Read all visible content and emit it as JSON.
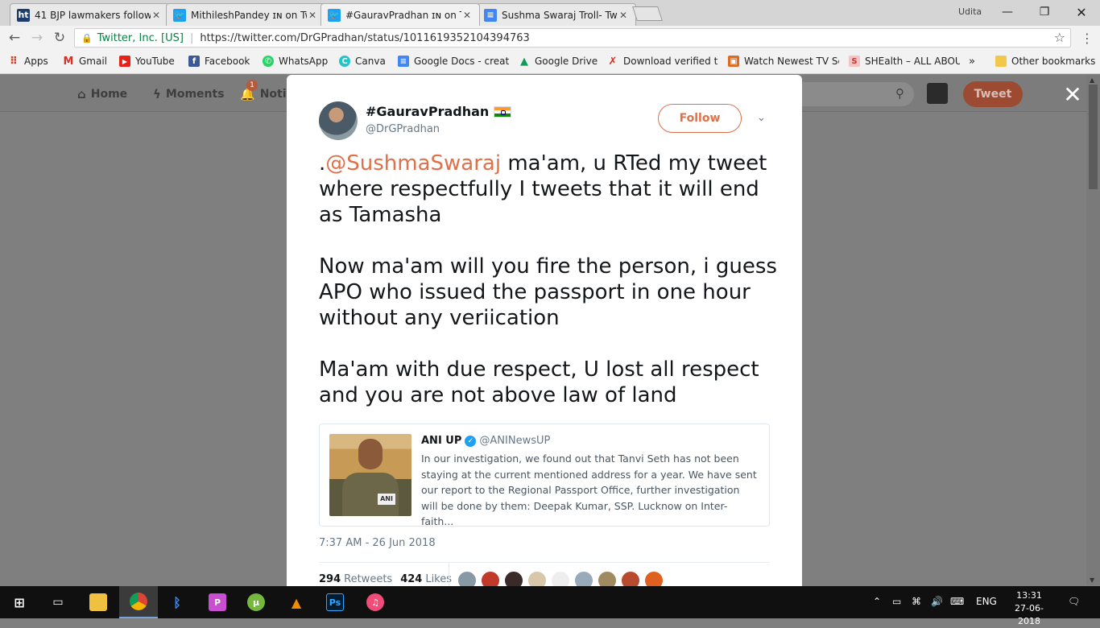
{
  "browser": {
    "tabs": [
      {
        "title": "41 BJP lawmakers follow",
        "icon": "ht-icon"
      },
      {
        "title": "MithileshPandey ɪɴ on Tw",
        "icon": "twitter-bird-icon"
      },
      {
        "title": "#GauravPradhan ɪɴ on Tw",
        "icon": "twitter-bird-icon"
      },
      {
        "title": "Sushma Swaraj Troll- Twit",
        "icon": "google-docs-icon"
      }
    ],
    "user_name": "Udita",
    "site_identity": "Twitter, Inc. [US]",
    "url": "https://twitter.com/DrGPradhan/status/1011619352104394763",
    "bookmarks": [
      {
        "label": "Apps",
        "icon": "apps-grid-icon"
      },
      {
        "label": "Gmail",
        "icon": "gmail-icon"
      },
      {
        "label": "YouTube",
        "icon": "youtube-icon"
      },
      {
        "label": "Facebook",
        "icon": "facebook-icon"
      },
      {
        "label": "WhatsApp",
        "icon": "whatsapp-icon"
      },
      {
        "label": "Canva",
        "icon": "canva-icon"
      },
      {
        "label": "Google Docs - create",
        "icon": "google-docs-icon"
      },
      {
        "label": "Google Drive",
        "icon": "google-drive-icon"
      },
      {
        "label": "Download verified to",
        "icon": "x-icon"
      },
      {
        "label": "Watch Newest TV Se",
        "icon": "tv-icon"
      },
      {
        "label": "SHEalth – ALL ABOU",
        "icon": "shealth-icon"
      }
    ],
    "more_bookmarks": "»",
    "other_bookmarks": "Other bookmarks"
  },
  "twitter_nav": {
    "home": "Home",
    "moments": "Moments",
    "notifications": "Notifi",
    "notification_count": "1",
    "search_placeholder": "r",
    "tweet_button": "Tweet"
  },
  "tweet": {
    "display_name": "#GauravPradhan",
    "handle": "@DrGPradhan",
    "follow_label": "Follow",
    "text_prefix": ".",
    "mention": "@SushmaSwaraj",
    "text_rest": " ma'am, u RTed my tweet where respectfully I tweets that it will end as Tamasha\n\nNow ma'am will you fire the person, i guess APO who issued the passport in one hour without any veriication\n\nMa'am with due respect, U lost all respect and you are not above law of land",
    "timestamp": "7:37 AM - 26 Jun 2018",
    "retweets_count": "294",
    "retweets_label": "Retweets",
    "likes_count": "424",
    "likes_label": "Likes"
  },
  "quoted_tweet": {
    "name": "ANI UP",
    "handle": "@ANINewsUP",
    "mic_label": "ANI",
    "text": "In our investigation, we found out that Tanvi Seth has not been staying at the current mentioned address for a year. We have sent our report to the Regional Passport Office, further investigation will be done by them: Deepak Kumar, SSP. Lucknow on Inter-faith..."
  },
  "taskbar": {
    "language": "ENG",
    "time": "13:31",
    "date": "27-06-2018",
    "apps": [
      "windows-start-icon",
      "task-view-icon",
      "file-explorer-icon",
      "chrome-icon",
      "bluetooth-icon",
      "picsart-icon",
      "utorrent-icon",
      "vlc-icon",
      "photoshop-icon",
      "itunes-icon"
    ]
  },
  "colors": {
    "twitter_accent": "#e0704a",
    "mention": "#e0704a",
    "overlay": "#7f7f7f"
  }
}
